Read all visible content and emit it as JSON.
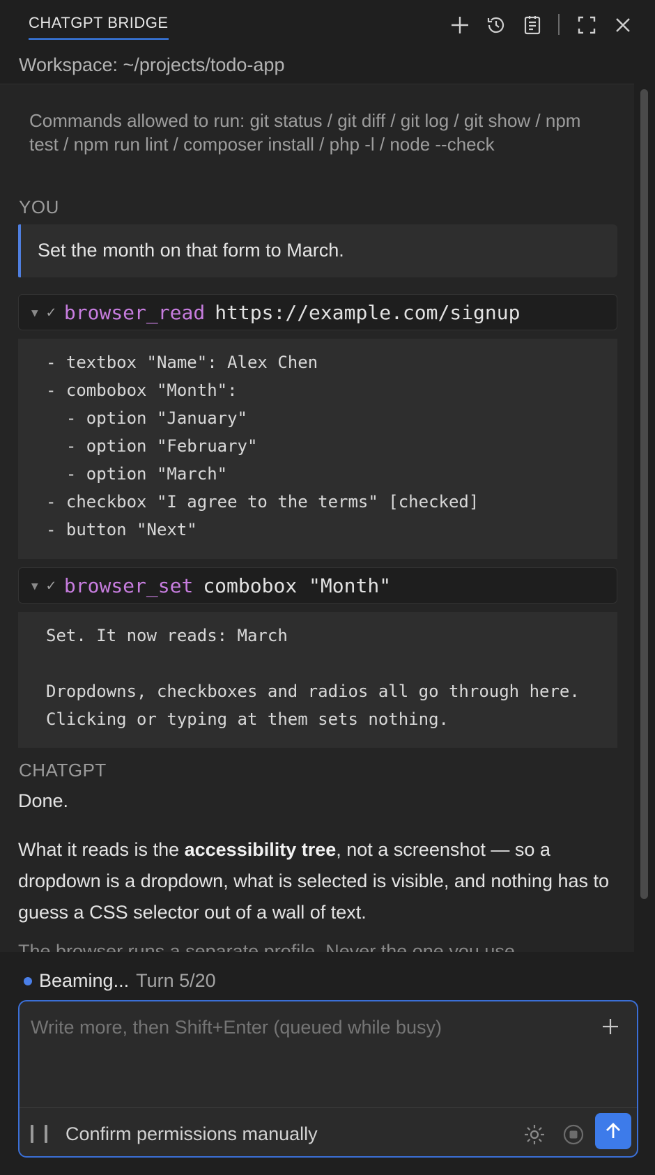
{
  "header": {
    "title": "CHATGPT BRIDGE",
    "icons": [
      "plus-icon",
      "history-icon",
      "notes-icon",
      "fullscreen-icon",
      "close-icon"
    ],
    "accent_color": "#3b82f6"
  },
  "workspace": "Workspace: ~/projects/todo-app",
  "allowed_commands": "Commands allowed to run: git status / git diff / git log / git show / npm test / npm run lint / composer install / php -l / node --check",
  "user": {
    "label": "YOU",
    "message": "Set the month on that form to March."
  },
  "tool_calls": [
    {
      "name": "browser_read",
      "arg": "https://example.com/signup",
      "output": [
        "- textbox \"Name\": Alex Chen",
        "- combobox \"Month\":",
        "  - option \"January\"",
        "  - option \"February\"",
        "  - option \"March\"",
        "- checkbox \"I agree to the terms\" [checked]",
        "- button \"Next\""
      ]
    },
    {
      "name": "browser_set",
      "arg": "combobox \"Month\"",
      "output": [
        "Set. It now reads: March",
        "",
        "Dropdowns, checkboxes and radios all go through here.",
        "Clicking or typing at them sets nothing."
      ]
    }
  ],
  "assistant": {
    "label": "CHATGPT",
    "done": "Done.",
    "p2_before": "What it reads is the ",
    "p2_bold": "accessibility tree",
    "p2_after": ", not a screenshot — so a dropdown is a dropdown, what is selected is visible, and nothing has to guess a CSS selector out of a wall of text.",
    "p3_partial": "The browser runs a separate profile. Never the one you use"
  },
  "status": {
    "state": "Beaming...",
    "turn": "Turn 5/20",
    "dot_color": "#4a7fe8"
  },
  "composer": {
    "placeholder": "Write more, then Shift+Enter (queued while busy)",
    "permission_label": "Confirm permissions manually",
    "send_color": "#3d7bea"
  }
}
